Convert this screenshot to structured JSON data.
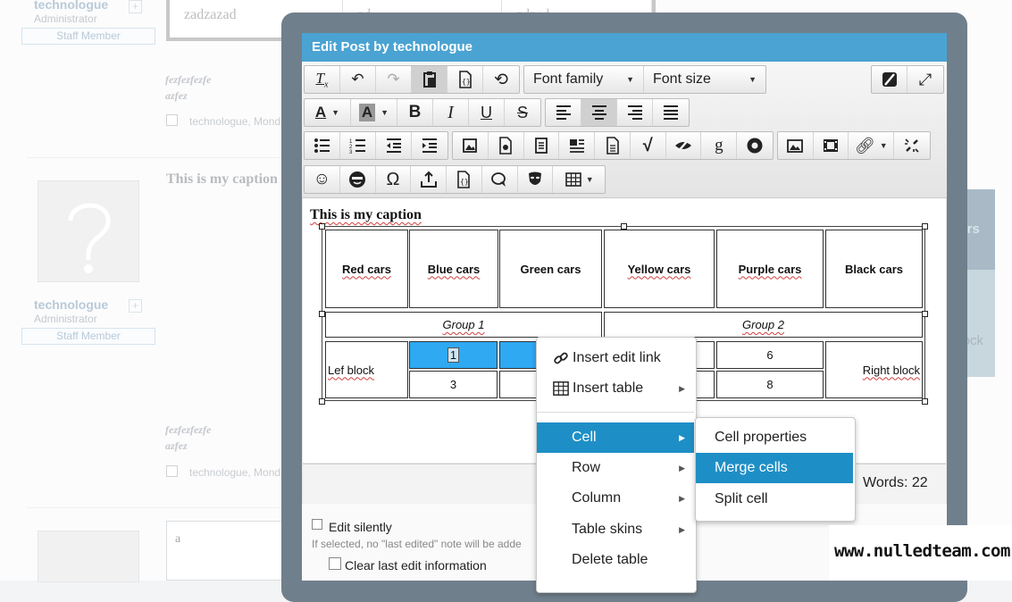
{
  "background": {
    "table_top_cells": [
      "zadzazad",
      "zd",
      "zdzad"
    ],
    "users": [
      {
        "name": "technologue",
        "role": "Administrator",
        "badge": "Staff Member"
      },
      {
        "name": "technologue",
        "role": "Administrator",
        "badge": "Staff Member"
      }
    ],
    "posts": [
      {
        "name": "fezfezfezfe",
        "sub": "azfez",
        "meta": "technologue, Monday"
      },
      {
        "name": "fezfezfezfe",
        "sub": "azfez",
        "meta": "technologue, Monday"
      }
    ],
    "caption": "This is my caption",
    "right_cells": [
      "cars",
      "block"
    ],
    "reply_text": "a"
  },
  "modal": {
    "title": "Edit Post by technologue",
    "toolbar": {
      "font_family": "Font family",
      "font_size": "Font size"
    },
    "editor": {
      "caption": "This is my caption",
      "headers": [
        "Red cars",
        "Blue cars",
        "Green cars",
        "Yellow cars",
        "Purple cars",
        "Black cars"
      ],
      "groups": [
        "Group 1",
        "Group 2"
      ],
      "left_block": "Lef block",
      "right_block": "Right block",
      "cells": [
        "1",
        "3",
        "6",
        "8"
      ]
    },
    "status": {
      "words": "Words: 22"
    },
    "options": {
      "edit_silently": "Edit silently",
      "edit_silently_hint": "If selected, no \"last edited\" note will be adde",
      "clear_last_edit": "Clear last edit information"
    }
  },
  "context_menu": {
    "items": [
      "Insert edit link",
      "Insert table",
      "Cell",
      "Row",
      "Column",
      "Table skins",
      "Delete table"
    ],
    "submenu": [
      "Cell properties",
      "Merge cells",
      "Split cell"
    ]
  },
  "watermark": "www.nulledteam.com",
  "colors": {
    "title_bar": "#4aa3d2",
    "menu_highlight": "#1e8fc6",
    "selected_cell": "#2ea9f2",
    "modal_frame": "#707f8c"
  }
}
